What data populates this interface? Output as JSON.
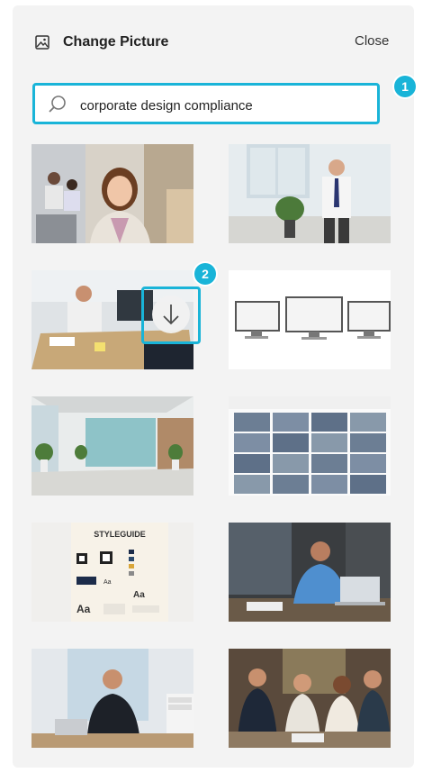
{
  "panel": {
    "title": "Change Picture",
    "close_label": "Close"
  },
  "search": {
    "value": "corporate design compliance",
    "placeholder": ""
  },
  "badges": [
    "1",
    "2"
  ],
  "styleguide": {
    "title": "STYLEGUIDE",
    "font_sample": "Aa"
  },
  "colors": {
    "accent": "#19b4d8"
  }
}
